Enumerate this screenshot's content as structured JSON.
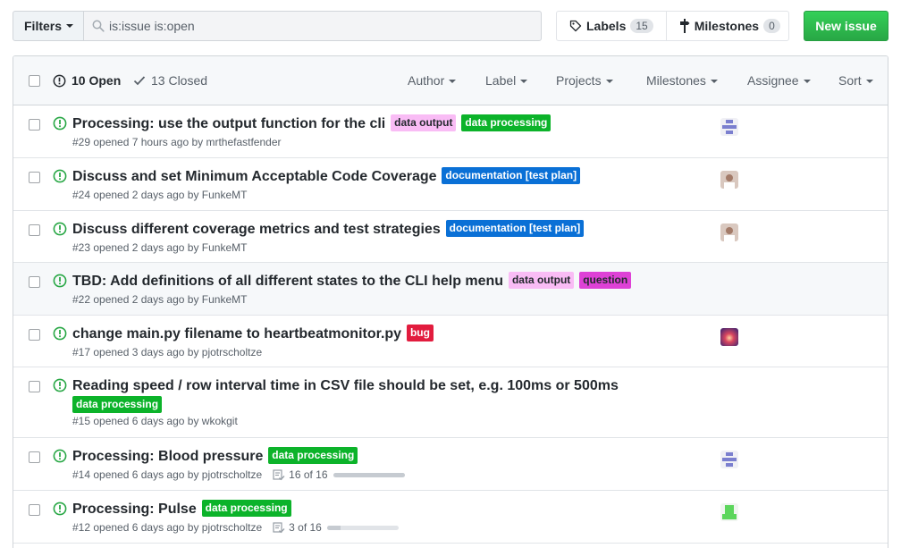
{
  "toolbar": {
    "filters_label": "Filters",
    "search_value": "is:issue is:open",
    "labels_label": "Labels",
    "labels_count": "15",
    "milestones_label": "Milestones",
    "milestones_count": "0",
    "new_issue_label": "New issue"
  },
  "header": {
    "open_label": "10 Open",
    "closed_label": "13 Closed",
    "filters": [
      "Author",
      "Label",
      "Projects",
      "Milestones",
      "Assignee",
      "Sort"
    ]
  },
  "colors": {
    "open_icon": "#28a745",
    "new_issue": "#28a745",
    "label_data_output": "#f9bcf5",
    "label_data_processing": "#0cb32a",
    "label_documentation": "#0a70d6",
    "label_question": "#de41d6",
    "label_bug": "#e21c3e"
  },
  "issues": [
    {
      "title": "Processing: use the output function for the cli",
      "labels": [
        "data output",
        "data processing"
      ],
      "meta": "#29 opened 7 hours ago by mrthefastfender",
      "avatar": "pixel-avatar-purple"
    },
    {
      "title": "Discuss and set Minimum Acceptable Code Coverage",
      "labels": [
        "documentation [test plan]"
      ],
      "meta": "#24 opened 2 days ago by FunkeMT",
      "avatar": "photo-avatar"
    },
    {
      "title": "Discuss different coverage metrics and test strategies",
      "labels": [
        "documentation [test plan]"
      ],
      "meta": "#23 opened 2 days ago by FunkeMT",
      "avatar": "photo-avatar"
    },
    {
      "title": "TBD: Add definitions of all different states to the CLI help menu",
      "labels": [
        "data output",
        "question"
      ],
      "meta": "#22 opened 2 days ago by FunkeMT",
      "avatar": ""
    },
    {
      "title": "change main.py filename to heartbeatmonitor.py",
      "labels": [
        "bug"
      ],
      "meta": "#17 opened 3 days ago by pjotrscholtze",
      "avatar": "photo-avatar-red"
    },
    {
      "title": "Reading speed / row interval time in CSV file should be set, e.g. 100ms or 500ms",
      "labels": [
        "data processing"
      ],
      "meta": "#15 opened 6 days ago by wkokgit",
      "avatar": ""
    },
    {
      "title": "Processing: Blood pressure",
      "labels": [
        "data processing"
      ],
      "meta": "#14 opened 6 days ago by pjotrscholtze",
      "tasks": "16 of 16",
      "task_progress": 1.0,
      "avatar": "pixel-avatar-purple"
    },
    {
      "title": "Processing: Pulse",
      "labels": [
        "data processing"
      ],
      "meta": "#12 opened 6 days ago by pjotrscholtze",
      "tasks": "3 of 16",
      "task_progress": 0.1875,
      "avatar": "pixel-avatar-green"
    }
  ]
}
